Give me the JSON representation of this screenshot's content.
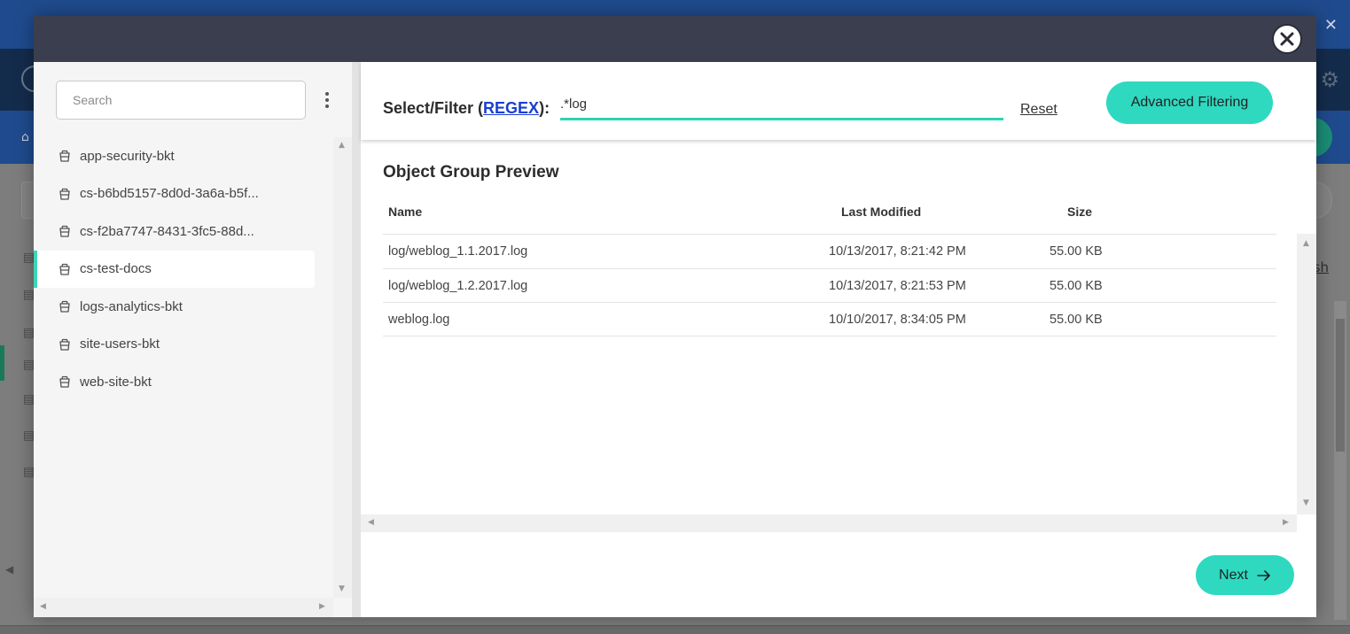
{
  "background": {
    "link_fragment": "sh"
  },
  "dialog": {
    "close_icon": "close-icon"
  },
  "sidebar": {
    "search_placeholder": "Search",
    "menu_icon": "kebab-menu-icon",
    "selected_index": 3,
    "buckets": [
      {
        "label": "app-security-bkt",
        "icon": "bucket-icon"
      },
      {
        "label": "cs-b6bd5157-8d0d-3a6a-b5f...",
        "icon": "bucket-icon"
      },
      {
        "label": "cs-f2ba7747-8431-3fc5-88d...",
        "icon": "bucket-icon"
      },
      {
        "label": "cs-test-docs",
        "icon": "bucket-icon"
      },
      {
        "label": "logs-analytics-bkt",
        "icon": "bucket-icon"
      },
      {
        "label": "site-users-bkt",
        "icon": "bucket-icon"
      },
      {
        "label": "web-site-bkt",
        "icon": "bucket-icon"
      }
    ]
  },
  "filter": {
    "label_prefix": "Select/Filter (",
    "regex_link": "REGEX",
    "label_suffix": "):",
    "value": ".*log",
    "reset_label": "Reset",
    "advanced_label": "Advanced Filtering"
  },
  "preview": {
    "title": "Object Group Preview",
    "columns": {
      "name": "Name",
      "modified": "Last Modified",
      "size": "Size"
    },
    "rows": [
      {
        "name": "log/weblog_1.1.2017.log",
        "modified": "10/13/2017, 8:21:42 PM",
        "size": "55.00 KB"
      },
      {
        "name": "log/weblog_1.2.2017.log",
        "modified": "10/13/2017, 8:21:53 PM",
        "size": "55.00 KB"
      },
      {
        "name": "weblog.log",
        "modified": "10/10/2017, 8:34:05 PM",
        "size": "55.00 KB"
      }
    ]
  },
  "footer": {
    "next_label": "Next",
    "next_icon": "arrow-right-icon"
  },
  "colors": {
    "accent": "#2ed9c0",
    "header": "#3b3e4f",
    "link": "#1a3fd0"
  }
}
